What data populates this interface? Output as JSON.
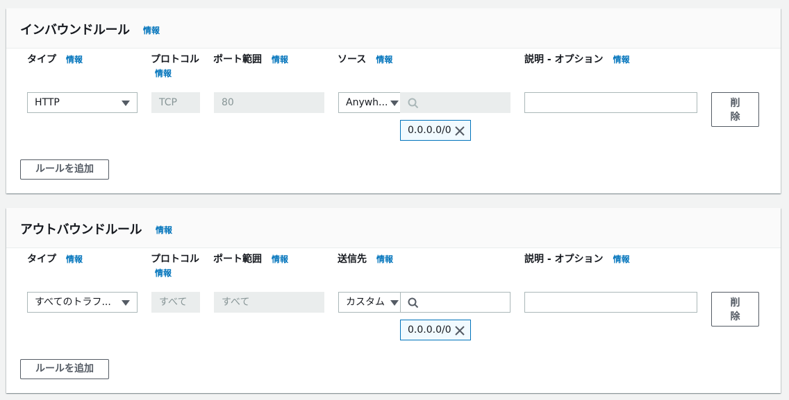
{
  "info_label": "情報",
  "inbound": {
    "title": "インバウンドルール",
    "columns": {
      "type": "タイプ",
      "protocol": "プロトコル",
      "port_range": "ポート範囲",
      "source": "ソース",
      "description": "説明 - オプション"
    },
    "rule": {
      "type_value": "HTTP",
      "protocol_value": "TCP",
      "port_value": "80",
      "source_value": "Anywh...",
      "cidr_token": "0.0.0.0/0",
      "description_value": ""
    },
    "delete_label": "削除",
    "add_rule_label": "ルールを追加"
  },
  "outbound": {
    "title": "アウトバウンドルール",
    "columns": {
      "type": "タイプ",
      "protocol": "プロトコル",
      "port_range": "ポート範囲",
      "destination": "送信先",
      "description": "説明 - オプション"
    },
    "rule": {
      "type_value": "すべてのトラフ...",
      "protocol_value": "すべて",
      "port_value": "すべて",
      "destination_value": "カスタム",
      "cidr_token": "0.0.0.0/0",
      "description_value": ""
    },
    "delete_label": "削除",
    "add_rule_label": "ルールを追加"
  },
  "colors": {
    "link": "#0073bb",
    "token_border": "#0073bb",
    "token_bg": "#f1faff",
    "disabled_bg": "#eaeded",
    "page_bg": "#f2f3f3"
  },
  "icons": {
    "select_caret": "caret-down-icon",
    "search": "search-icon",
    "remove_token": "close-icon"
  }
}
